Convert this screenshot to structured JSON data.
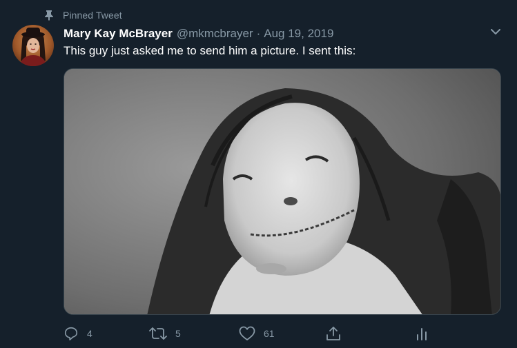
{
  "pinned": {
    "label": "Pinned Tweet",
    "icon": "pin-icon"
  },
  "author": {
    "display_name": "Mary Kay McBrayer",
    "handle": "@mkmcbrayer",
    "separator": "·",
    "date": "Aug 19, 2019"
  },
  "tweet": {
    "text": "This guy just asked me to send him a picture. I sent this:"
  },
  "media": {
    "description_icon": "photo"
  },
  "actions": {
    "reply": {
      "icon": "reply-icon",
      "count": "4"
    },
    "retweet": {
      "icon": "retweet-icon",
      "count": "5"
    },
    "like": {
      "icon": "heart-icon",
      "count": "61"
    },
    "share": {
      "icon": "share-icon"
    },
    "analytics": {
      "icon": "analytics-icon"
    }
  },
  "colors": {
    "background": "#15202b",
    "muted": "#8899a6",
    "text": "#ffffff",
    "border": "#38444d"
  }
}
